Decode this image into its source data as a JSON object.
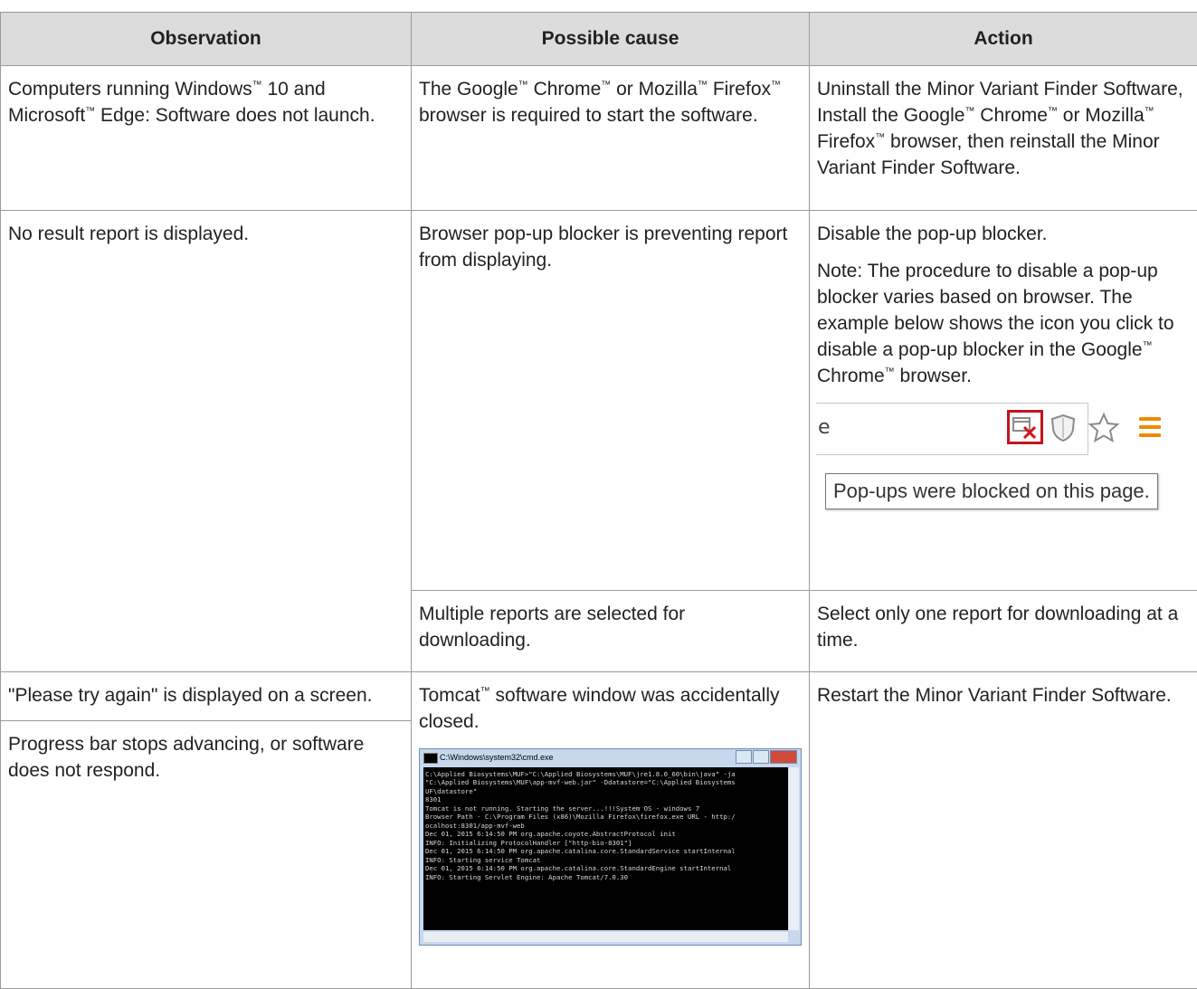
{
  "table": {
    "headers": {
      "observation": "Observation",
      "cause": "Possible cause",
      "action": "Action"
    },
    "row1": {
      "obs_a": "Computers running Windows",
      "obs_b": " 10 and Microsoft",
      "obs_c": " Edge: Software does not launch.",
      "cause_a": "The Google",
      "cause_b": " Chrome",
      "cause_c": " or Mozilla",
      "cause_d": " Firefox",
      "cause_e": " browser is required to start the software.",
      "act_a": "Uninstall the Minor Variant Finder Software, Install the Google",
      "act_b": " Chrome",
      "act_c": " or Mozilla",
      "act_d": " Firefox",
      "act_e": " browser, then reinstall the Minor Variant Finder Software."
    },
    "row2": {
      "obs": "No result report is displayed.",
      "cause1": "Browser pop-up blocker is preventing report from displaying.",
      "act1": "Disable the pop-up blocker.",
      "note_label": "Note:",
      "note_a": "  The procedure to disable a pop-up blocker varies based on browser. The example below shows the icon you click to disable a pop-up blocker in the Google",
      "note_b": " Chrome",
      "note_c": " browser.",
      "browser_addr_text": "e",
      "tooltip": "Pop-ups were blocked on this page.",
      "cause2": "Multiple reports are selected for downloading.",
      "act2": "Select only one report for downloading at a time."
    },
    "row3": {
      "obs1": "\"Please try again\" is displayed on a screen.",
      "obs2": "Progress bar stops advancing, or software does not respond.",
      "cause_a": "Tomcat",
      "cause_b": " software window was accidentally closed.",
      "act": "Restart the Minor Variant Finder Software.",
      "cmd_title": "C:\\Windows\\system32\\cmd.exe",
      "cmd_text": "C:\\Applied Biosystems\\MUF>\"C:\\Applied Biosystems\\MUF\\jre1.8.0_60\\bin\\java\" -ja\n\"C:\\Applied Biosystems\\MUF\\app-mvf-web.jar\" -Ddatastore=\"C:\\Applied Biosystems\nUF\\datastore\"\n8301\nTomcat is not running. Starting the server...!!!System OS - windows 7\nBrowser Path - C:\\Program Files (x86)\\Mozilla Firefox\\firefox.exe URL - http:/\nocalhost:8301/app-mvf-web\nDec 01, 2015 6:14:50 PM org.apache.coyote.AbstractProtocol init\nINFO: Initializing ProtocolHandler [\"http-bio-8301\"]\nDec 01, 2015 6:14:50 PM org.apache.catalina.core.StandardService startInternal\nINFO: Starting service Tomcat\nDec 01, 2015 6:14:50 PM org.apache.catalina.core.StandardEngine startInternal\nINFO: Starting Servlet Engine: Apache Tomcat/7.0.30"
    },
    "tm": "™"
  }
}
